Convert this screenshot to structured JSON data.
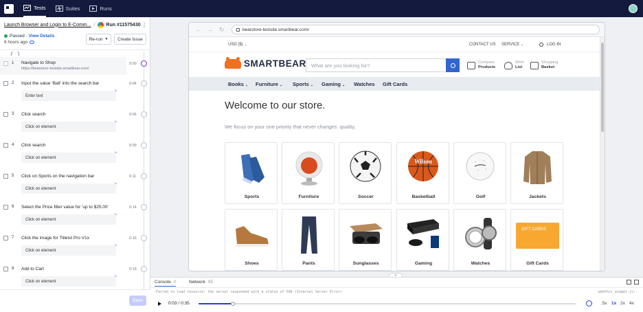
{
  "nav": {
    "items": [
      {
        "label": "Tests"
      },
      {
        "label": "Suites"
      },
      {
        "label": "Runs"
      }
    ]
  },
  "test": {
    "title": "Launch Browser and Login to E-Comm...",
    "run": "Run #11575430",
    "status": "Passed",
    "view_details": "View Details",
    "ago": "6 hours ago",
    "rerun": "Re-run",
    "create_issue": "Create Issue",
    "save": "Save"
  },
  "steps": [
    {
      "num": "1",
      "text": "Navigate to Shop",
      "url": "https://bearstore-testsite.smartbear.com/",
      "time": "0:00"
    },
    {
      "num": "2",
      "text": "Input the value 'Ball' into the search bar",
      "field": "Enter text",
      "time": "0:04"
    },
    {
      "num": "3",
      "text": "Click search",
      "field": "Click on element",
      "time": "0:06"
    },
    {
      "num": "4",
      "text": "Click search",
      "field": "Click on element",
      "time": "0:09"
    },
    {
      "num": "5",
      "text": "Click on Sports on the navigation bar",
      "field": "Click on element",
      "time": "0:11"
    },
    {
      "num": "6",
      "text": "Select the Price filter value for 'up to $25.00'",
      "field": "Click on element",
      "time": "0:14"
    },
    {
      "num": "7",
      "text": "Click the image for Titleist Pro V1x",
      "field": "Click on element",
      "time": "0:16"
    },
    {
      "num": "8",
      "text": "Add to Cart",
      "field": "Click on element",
      "time": "0:19"
    }
  ],
  "browser": {
    "url": "bearstore-testsite.smartbear.com/"
  },
  "site": {
    "currency": "USD ($)",
    "contact": "CONTACT US",
    "service": "SERVICE",
    "login": "LOG IN",
    "brand": "SMARTBEAR",
    "search_placeholder": "What are you looking for?",
    "compare_top": "Compare",
    "compare_bottom": "Products",
    "wish_top": "Wish",
    "wish_bottom": "List",
    "cart_top": "Shopping",
    "cart_bottom": "Basket",
    "categories": [
      "Books",
      "Furniture",
      "Sports",
      "Gaming",
      "Watches",
      "Gift Cards"
    ],
    "welcome": "Welcome to our store.",
    "tagline": "We focus on your one priority that never changes: quality.",
    "tiles": [
      "Sports",
      "Furniture",
      "Soccer",
      "Basketball",
      "Golf",
      "Jackets",
      "Shoes",
      "Pants",
      "Sunglasses",
      "Gaming",
      "Watches",
      "Gift Cards"
    ],
    "gift_card_text": "GIFT CARDS",
    "basketball_text": "Wilson"
  },
  "devtools": {
    "console_label": "Console",
    "console_count": "0",
    "network_label": "Network",
    "network_count": "95",
    "error": "Failed to load resource: the server responded with a status of 500 (Internal Server Error)",
    "error_src": "addthis_widget.js:-"
  },
  "player": {
    "time": "0:03 / 0:35",
    "progress": 0.091,
    "speeds": [
      ".5x",
      "1x",
      "2x",
      "4x"
    ],
    "selected_speed": "1x"
  }
}
